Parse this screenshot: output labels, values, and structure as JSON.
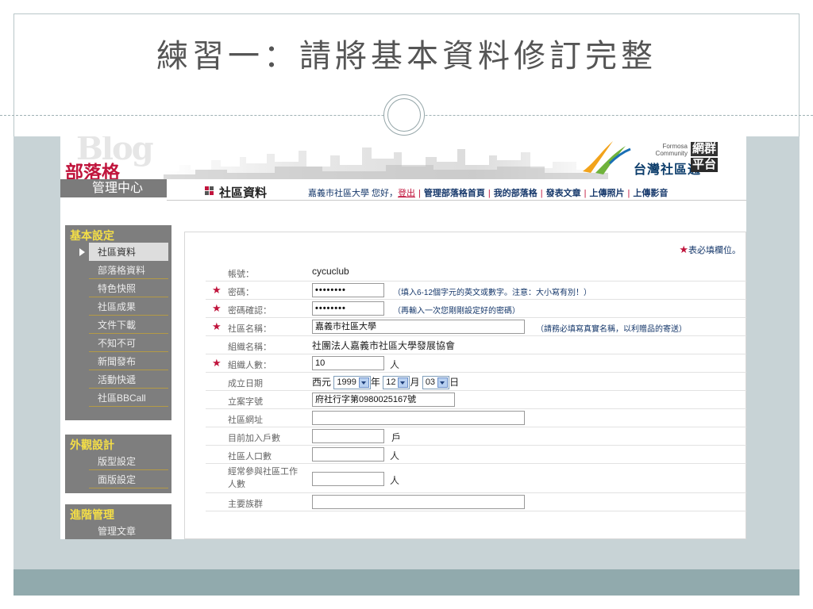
{
  "slide": {
    "title": "練習一：請將基本資料修訂完整"
  },
  "banner": {
    "blog_watermark": "Blog",
    "logo_main": "部落格",
    "logo_sub": "管理中心",
    "brand_formosa": "Formosa\nCommunity",
    "brand_net": "網群",
    "brand_tw": "台灣社區通",
    "brand_platform": "平台"
  },
  "nav": {
    "section_title": "社區資料",
    "greeting": "嘉義市社區大學 您好，",
    "logout": "登出",
    "links": [
      "管理部落格首頁",
      "我的部落格",
      "發表文章",
      "上傳照片",
      "上傳影音"
    ]
  },
  "sidebar": {
    "sections": [
      {
        "title": "基本設定",
        "items": [
          "社區資料",
          "部落格資料",
          "特色快照",
          "社區成果",
          "文件下載",
          "不知不可",
          "新聞發布",
          "活動快遞",
          "社區BBCall"
        ]
      },
      {
        "title": "外觀設計",
        "items": [
          "版型設定",
          "面版設定"
        ]
      },
      {
        "title": "進階管理",
        "items": [
          "管理文章"
        ]
      }
    ],
    "active_item": "社區資料"
  },
  "form": {
    "required_note": "表必填欄位。",
    "required_star": "★",
    "account": {
      "label": "帳號：",
      "value": "cycuclub"
    },
    "password": {
      "label": "密碼：",
      "value": "••••••••",
      "hint": "（填入6-12個字元的英文或數字。注意：大小寫有別！）"
    },
    "password_confirm": {
      "label": "密碼確認：",
      "value": "••••••••",
      "hint": "（再輸入一次您剛剛設定好的密碼）"
    },
    "community_name": {
      "label": "社區名稱：",
      "value": "嘉義市社區大學",
      "hint": "（請務必填寫真實名稱，以利贈品的寄送）"
    },
    "org_name": {
      "label": "組織名稱：",
      "value": "社團法人嘉義市社區大學發展協會"
    },
    "org_members": {
      "label": "組織人數：",
      "value": "10",
      "unit": "人"
    },
    "founded": {
      "label": "成立日期",
      "era": "西元",
      "year": "1999",
      "year_unit": "年",
      "month": "12",
      "month_unit": "月",
      "day": "03",
      "day_unit": "日"
    },
    "registration_no": {
      "label": "立案字號",
      "value": "府社行字第0980025167號"
    },
    "website": {
      "label": "社區網址",
      "value": ""
    },
    "households": {
      "label": "目前加入戶數",
      "value": "",
      "unit": "戶"
    },
    "population": {
      "label": "社區人口數",
      "value": "",
      "unit": "人"
    },
    "participants": {
      "label": "經常參與社區工作人數",
      "value": "",
      "unit": "人"
    },
    "ethnic_group": {
      "label": "主要族群",
      "value": ""
    }
  },
  "colors": {
    "accent_red": "#c0143c",
    "sidebar_gold": "#f5df46",
    "link_blue": "#16386b",
    "band": "#c8d3d6",
    "footer_band": "#91aaad"
  }
}
